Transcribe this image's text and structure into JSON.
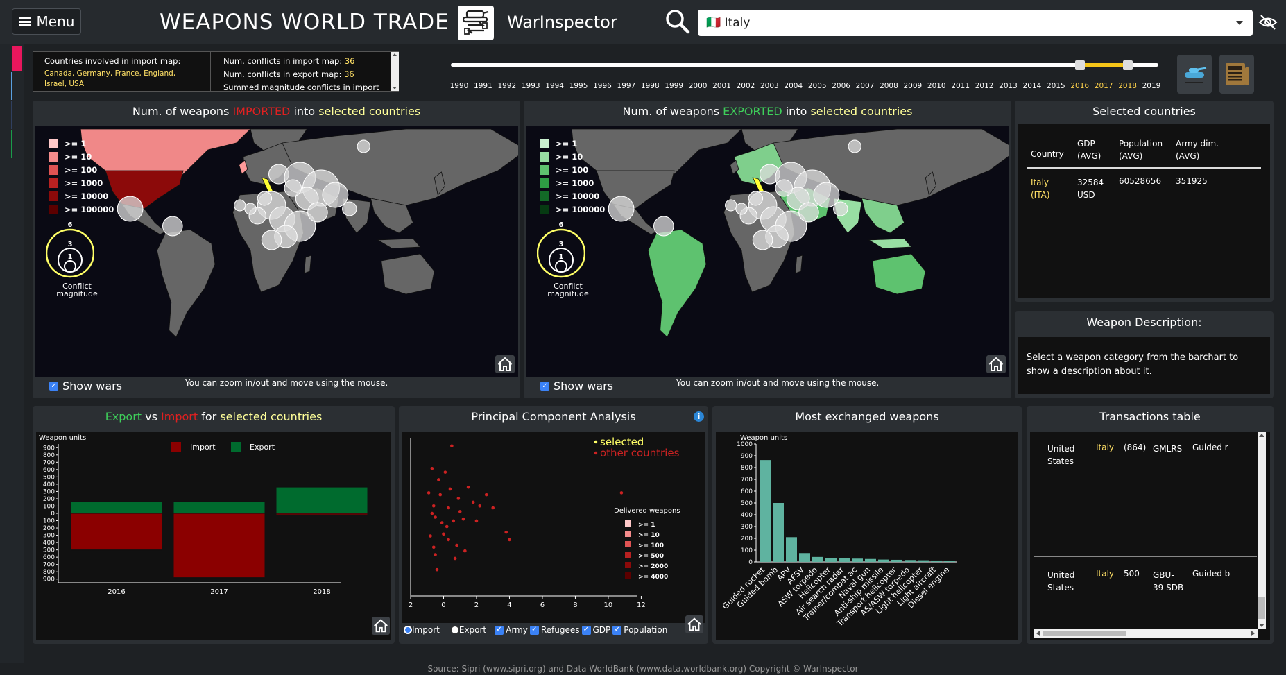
{
  "header": {
    "menu_label": "Menu",
    "title": "WEAPONS WORLD TRADE",
    "brand": "WarInspector",
    "country_selected": "🇮🇹 Italy"
  },
  "info": {
    "countries_label": "Countries involved in import map:",
    "countries_list": "Canada, Germany, France, England, Israel, USA",
    "conflicts_import_label": "Num. conflicts in import map:",
    "conflicts_import_value": "36",
    "conflicts_export_label": "Num. conflicts in export map:",
    "conflicts_export_value": "36",
    "summed_label": "Summed magnitude conflicts in import"
  },
  "timeline": {
    "years": [
      "1990",
      "1991",
      "1992",
      "1993",
      "1994",
      "1995",
      "1996",
      "1997",
      "1998",
      "1999",
      "2000",
      "2001",
      "2002",
      "2003",
      "2004",
      "2005",
      "2006",
      "2007",
      "2008",
      "2009",
      "2010",
      "2011",
      "2012",
      "2013",
      "2014",
      "2015",
      "2016",
      "2017",
      "2018",
      "2019"
    ],
    "range_start": "2016",
    "range_end": "2018"
  },
  "import_map": {
    "title_pre": "Num. of weapons ",
    "title_hl": "IMPORTED",
    "title_mid": " into ",
    "title_sel": "selected countries",
    "legend": [
      ">= 1",
      ">= 10",
      ">= 100",
      ">= 1000",
      ">= 10000",
      ">= 100000"
    ],
    "legend_colors": [
      "#ffc9c9",
      "#f58c8c",
      "#e05353",
      "#b82121",
      "#8c0a0a",
      "#5c0000"
    ],
    "circle_labels": [
      "6",
      "3",
      "1"
    ],
    "conflict_label": "Conflict magnitude",
    "show_wars": "Show wars",
    "zoom_note": "You can zoom in/out and move using the mouse."
  },
  "export_map": {
    "title_pre": "Num. of weapons ",
    "title_hl": "EXPORTED",
    "title_mid": " into ",
    "title_sel": "selected countries",
    "legend": [
      ">= 1",
      ">= 10",
      ">= 100",
      ">= 1000",
      ">= 10000",
      ">= 100000"
    ],
    "legend_colors": [
      "#c9f0cf",
      "#98dea3",
      "#5ec26f",
      "#2e9c44",
      "#136a27",
      "#063a12"
    ],
    "circle_labels": [
      "6",
      "3",
      "1"
    ],
    "conflict_label": "Conflict magnitude",
    "show_wars": "Show wars",
    "zoom_note": "You can zoom in/out and move using the mouse."
  },
  "selected_countries": {
    "title": "Selected countries",
    "columns": [
      "Country",
      "GDP (AVG)",
      "Population (AVG)",
      "Army dim. (AVG)"
    ],
    "rows": [
      {
        "country": "Italy (ITA)",
        "gdp": "32584 USD",
        "population": "60528656",
        "army": "351925"
      }
    ]
  },
  "weapon_description": {
    "title": "Weapon Description:",
    "text": "Select a weapon category from the barchart to show a description about it."
  },
  "export_import": {
    "title_export": "Export",
    "title_vs": " vs ",
    "title_import": "Import",
    "title_for": " for ",
    "title_sel": "selected countries",
    "ylabel": "Weapon units",
    "legend_import": "Import",
    "legend_export": "Export"
  },
  "pca": {
    "title": "Principal Component Analysis",
    "legend_selected": "selected",
    "legend_other": "other countries",
    "delivered_title": "Delivered weapons",
    "delivered_levels": [
      ">= 1",
      ">= 10",
      ">= 100",
      ">= 500",
      ">= 2000",
      ">= 4000"
    ],
    "options": {
      "import": "Import",
      "export": "Export",
      "army": "Army",
      "refugees": "Refugees",
      "gdp": "GDP",
      "population": "Population"
    }
  },
  "most_exchanged": {
    "title": "Most exchanged weapons",
    "ylabel": "Weapon units"
  },
  "transactions": {
    "title": "Transactions table",
    "rows": [
      {
        "from": "United States",
        "to": "Italy",
        "qty": "(864)",
        "weapon": "GMLRS",
        "category": "Guided r"
      },
      {
        "from": "United States",
        "to": "Italy",
        "qty": "500",
        "weapon": "GBU-39 SDB",
        "category": "Guided b"
      }
    ]
  },
  "footer": {
    "text": "Source: Sipri (www.sipri.org) and Data WorldBank (www.data.worldbank.org) Copyright © WarInspector"
  },
  "chart_data": [
    {
      "type": "bar",
      "title": "Export vs Import for selected countries",
      "ylabel": "Weapon units",
      "categories": [
        "2016",
        "2017",
        "2018"
      ],
      "series": [
        {
          "name": "Import",
          "values": [
            500,
            880,
            20
          ]
        },
        {
          "name": "Export",
          "values": [
            160,
            160,
            360
          ]
        }
      ],
      "ylim": [
        -950,
        950
      ],
      "yticks": [
        900,
        800,
        700,
        600,
        500,
        400,
        300,
        200,
        100,
        0,
        100,
        200,
        300,
        400,
        500,
        600,
        700,
        800,
        900
      ],
      "colors": {
        "Import": "#8b0000",
        "Export": "#006b2e"
      },
      "legend": "top"
    },
    {
      "type": "scatter",
      "title": "Principal Component Analysis",
      "xticks": [
        "2",
        "0",
        "2",
        "4",
        "6",
        "8",
        "10",
        "12"
      ],
      "xlim": [
        -2,
        13
      ],
      "ylim": [
        -4.2,
        4.2
      ],
      "series": [
        {
          "name": "other countries",
          "points": [
            [
              -0.7,
              2.6
            ],
            [
              0.5,
              3.8
            ],
            [
              -0.2,
              1.2
            ],
            [
              0.3,
              0.5
            ],
            [
              -0.5,
              0.0
            ],
            [
              0.2,
              -0.5
            ],
            [
              -0.8,
              -1.0
            ],
            [
              1.0,
              0.3
            ],
            [
              0.8,
              -1.5
            ],
            [
              2.2,
              0.6
            ],
            [
              2.6,
              1.2
            ],
            [
              3.0,
              0.5
            ],
            [
              3.8,
              -0.8
            ],
            [
              4.0,
              -1.2
            ],
            [
              1.3,
              -1.8
            ],
            [
              -0.4,
              -2.8
            ],
            [
              -0.6,
              -1.6
            ],
            [
              0.0,
              -0.9
            ],
            [
              0.4,
              1.5
            ],
            [
              -0.3,
              2.0
            ],
            [
              1.8,
              0.8
            ],
            [
              0.6,
              -0.2
            ],
            [
              -0.1,
              -0.3
            ],
            [
              0.9,
              1.0
            ],
            [
              10.8,
              1.3
            ],
            [
              -0.9,
              1.3
            ],
            [
              -0.6,
              0.6
            ],
            [
              0.1,
              2.4
            ],
            [
              1.5,
              1.6
            ],
            [
              -0.5,
              -2.0
            ],
            [
              0.7,
              -2.2
            ],
            [
              0.3,
              -1.2
            ],
            [
              -0.7,
              0.2
            ],
            [
              1.2,
              -0.1
            ],
            [
              2.0,
              -0.2
            ]
          ]
        },
        {
          "name": "selected",
          "points": []
        }
      ],
      "legend": "top-right",
      "colors": {
        "selected": "#ffff66",
        "other countries": "#cc2222"
      }
    },
    {
      "type": "bar",
      "title": "Most exchanged weapons",
      "ylabel": "Weapon units",
      "categories": [
        "Guided rocket",
        "Guided bomb",
        "APV",
        "AFSV",
        "ASW torpedo",
        "Helicopter",
        "Air search radar",
        "Trainer/combat ac",
        "Naval gun",
        "Anti-ship missile",
        "Transport helicopter",
        "AS/ASW torpedo",
        "Light helicopter",
        "Light aircraft",
        "Diesel engine"
      ],
      "values": [
        864,
        500,
        210,
        75,
        42,
        35,
        30,
        28,
        25,
        20,
        18,
        16,
        14,
        12,
        10
      ],
      "ylim": [
        0,
        1000
      ],
      "yticks": [
        0,
        100,
        200,
        300,
        400,
        500,
        600,
        700,
        800,
        900,
        1000
      ],
      "color": "#5fb3a0"
    }
  ]
}
